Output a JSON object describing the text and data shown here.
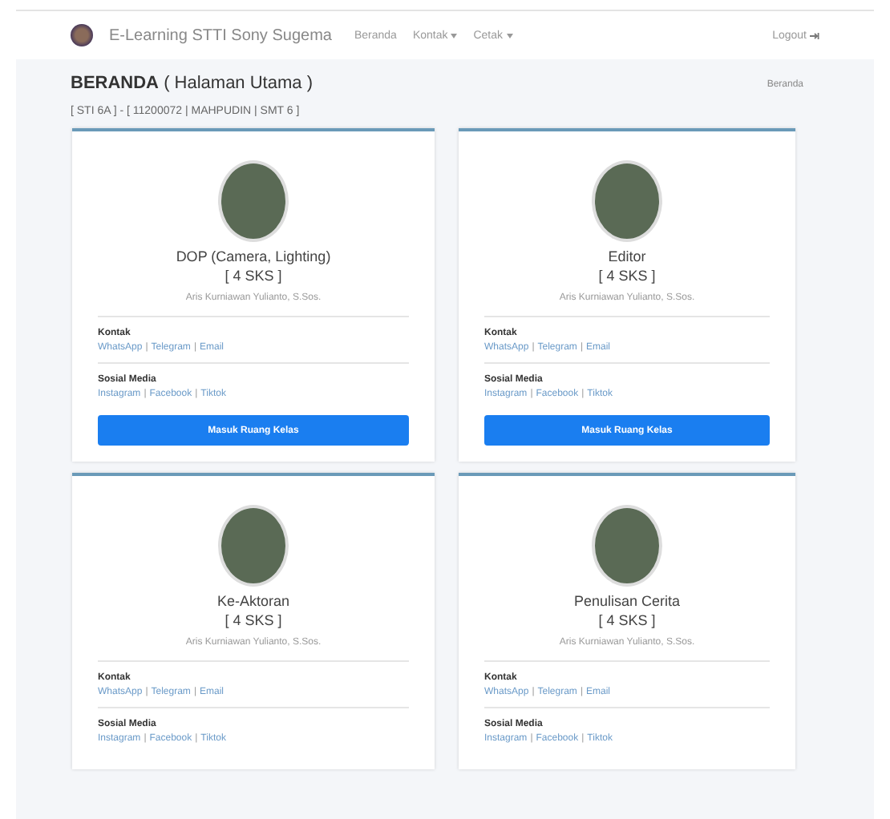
{
  "navbar": {
    "brand": "E-Learning STTI Sony Sugema",
    "items": [
      {
        "label": "Beranda",
        "dropdown": false
      },
      {
        "label": "Kontak",
        "dropdown": true
      },
      {
        "label": "Cetak",
        "dropdown": true
      }
    ],
    "logout": "Logout"
  },
  "header": {
    "title": "BERANDA",
    "subtitle": "( Halaman Utama )",
    "info": "[ STI 6A ] - [ 11200072 | MAHPUDIN | SMT 6 ]",
    "breadcrumb": "Beranda"
  },
  "separator": "|",
  "courses": [
    {
      "name": "DOP (Camera, Lighting)",
      "sks": "[ 4 SKS ]",
      "lecturer": "Aris Kurniawan Yulianto, S.Sos.",
      "contact_label": "Kontak",
      "contacts": [
        "WhatsApp",
        "Telegram",
        "Email"
      ],
      "social_label": "Sosial Media",
      "socials": [
        "Instagram",
        "Facebook",
        "Tiktok"
      ],
      "button": "Masuk Ruang Kelas"
    },
    {
      "name": "Editor",
      "sks": "[ 4 SKS ]",
      "lecturer": "Aris Kurniawan Yulianto, S.Sos.",
      "contact_label": "Kontak",
      "contacts": [
        "WhatsApp",
        "Telegram",
        "Email"
      ],
      "social_label": "Sosial Media",
      "socials": [
        "Instagram",
        "Facebook",
        "Tiktok"
      ],
      "button": "Masuk Ruang Kelas"
    },
    {
      "name": "Ke-Aktoran",
      "sks": "[ 4 SKS ]",
      "lecturer": "Aris Kurniawan Yulianto, S.Sos.",
      "contact_label": "Kontak",
      "contacts": [
        "WhatsApp",
        "Telegram",
        "Email"
      ],
      "social_label": "Sosial Media",
      "socials": [
        "Instagram",
        "Facebook",
        "Tiktok"
      ]
    },
    {
      "name": "Penulisan Cerita",
      "sks": "[ 4 SKS ]",
      "lecturer": "Aris Kurniawan Yulianto, S.Sos.",
      "contact_label": "Kontak",
      "contacts": [
        "WhatsApp",
        "Telegram",
        "Email"
      ],
      "social_label": "Sosial Media",
      "socials": [
        "Instagram",
        "Facebook",
        "Tiktok"
      ]
    }
  ]
}
